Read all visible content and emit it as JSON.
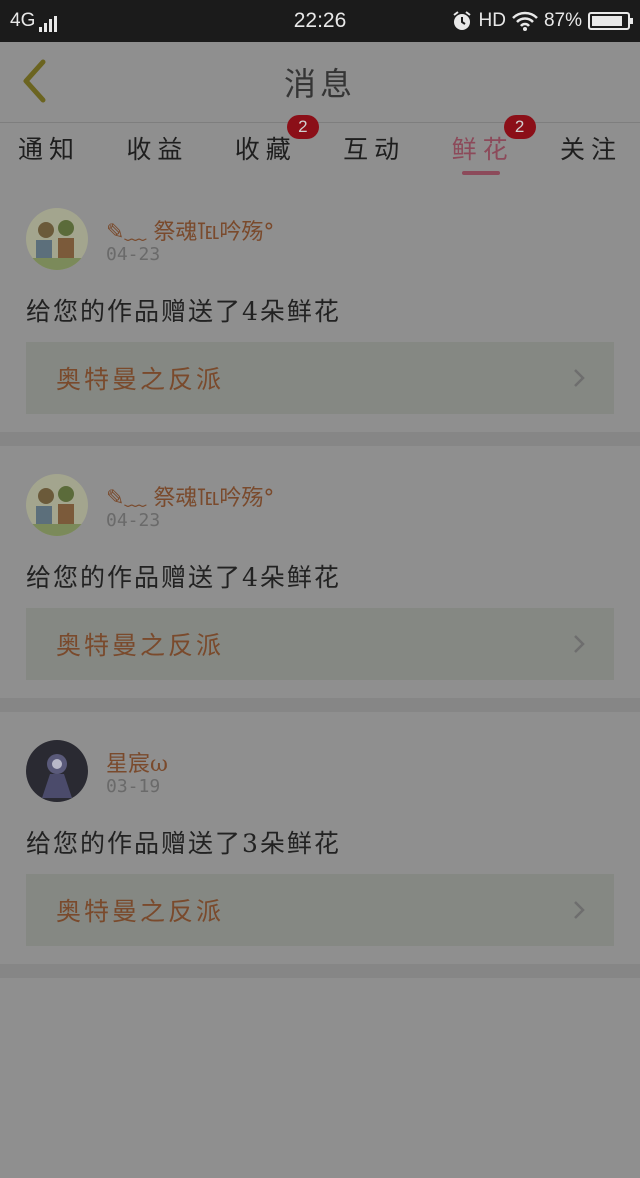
{
  "status_bar": {
    "network": "4G",
    "time": "22:26",
    "hd": "HD",
    "battery": "87%"
  },
  "header": {
    "title": "消息"
  },
  "tabs": [
    {
      "label": "通知"
    },
    {
      "label": "收益"
    },
    {
      "label": "收藏",
      "badge": "2"
    },
    {
      "label": "互动"
    },
    {
      "label": "鲜花",
      "badge": "2",
      "active": true
    },
    {
      "label": "关注"
    }
  ],
  "messages": [
    {
      "user": "✎﹏ 祭魂℡吟殇°",
      "date": "04-23",
      "text": "给您的作品赠送了4朵鲜花",
      "work": "奥特曼之反派"
    },
    {
      "user": "✎﹏ 祭魂℡吟殇°",
      "date": "04-23",
      "text": "给您的作品赠送了4朵鲜花",
      "work": "奥特曼之反派"
    },
    {
      "user": "星宸ω",
      "date": "03-19",
      "text": "给您的作品赠送了3朵鲜花",
      "work": "奥特曼之反派"
    }
  ],
  "colors": {
    "accent": "#8c4a5a",
    "badge": "#8b0f18",
    "username": "#7a4a2c"
  }
}
